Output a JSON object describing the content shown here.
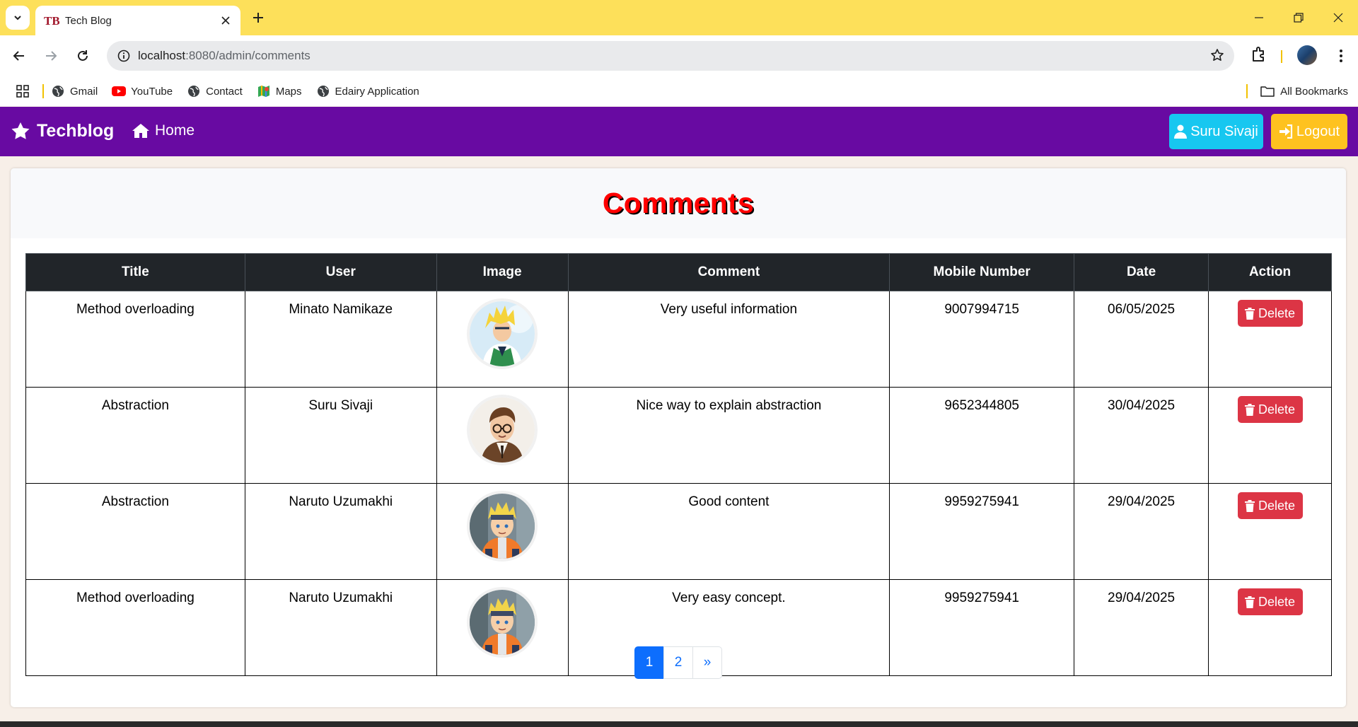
{
  "browser": {
    "tab_title": "Tech Blog",
    "url_host": "localhost",
    "url_path": ":8080/admin/comments",
    "bookmarks": [
      {
        "label": "Gmail",
        "icon": "globe-icon"
      },
      {
        "label": "YouTube",
        "icon": "youtube-icon"
      },
      {
        "label": "Contact",
        "icon": "globe-icon"
      },
      {
        "label": "Maps",
        "icon": "maps-icon"
      },
      {
        "label": "Edairy Application",
        "icon": "globe-icon"
      }
    ],
    "all_bookmarks_label": "All Bookmarks",
    "theme_color": "#fde05a"
  },
  "navbar": {
    "brand": "Techblog",
    "home_label": "Home",
    "user_label": "Suru Sivaji",
    "logout_label": "Logout",
    "background": "#680aa2"
  },
  "page": {
    "title": "Comments"
  },
  "table": {
    "headers": [
      "Title",
      "User",
      "Image",
      "Comment",
      "Mobile Number",
      "Date",
      "Action"
    ],
    "rows": [
      {
        "title": "Method overloading",
        "user": "Minato Namikaze",
        "comment": "Very useful information",
        "mobile": "9007994715",
        "date": "06/05/2025",
        "action": "Delete",
        "avatar": "minato"
      },
      {
        "title": "Abstraction",
        "user": "Suru Sivaji",
        "comment": "Nice way to explain abstraction",
        "mobile": "9652344805",
        "date": "30/04/2025",
        "action": "Delete",
        "avatar": "suru"
      },
      {
        "title": "Abstraction",
        "user": "Naruto Uzumakhi",
        "comment": "Good content",
        "mobile": "9959275941",
        "date": "29/04/2025",
        "action": "Delete",
        "avatar": "naruto"
      },
      {
        "title": "Method overloading",
        "user": "Naruto Uzumakhi",
        "comment": "Very easy concept.",
        "mobile": "9959275941",
        "date": "29/04/2025",
        "action": "Delete",
        "avatar": "naruto"
      }
    ]
  },
  "pagination": {
    "pages": [
      "1",
      "2"
    ],
    "active": "1",
    "next": "»"
  }
}
